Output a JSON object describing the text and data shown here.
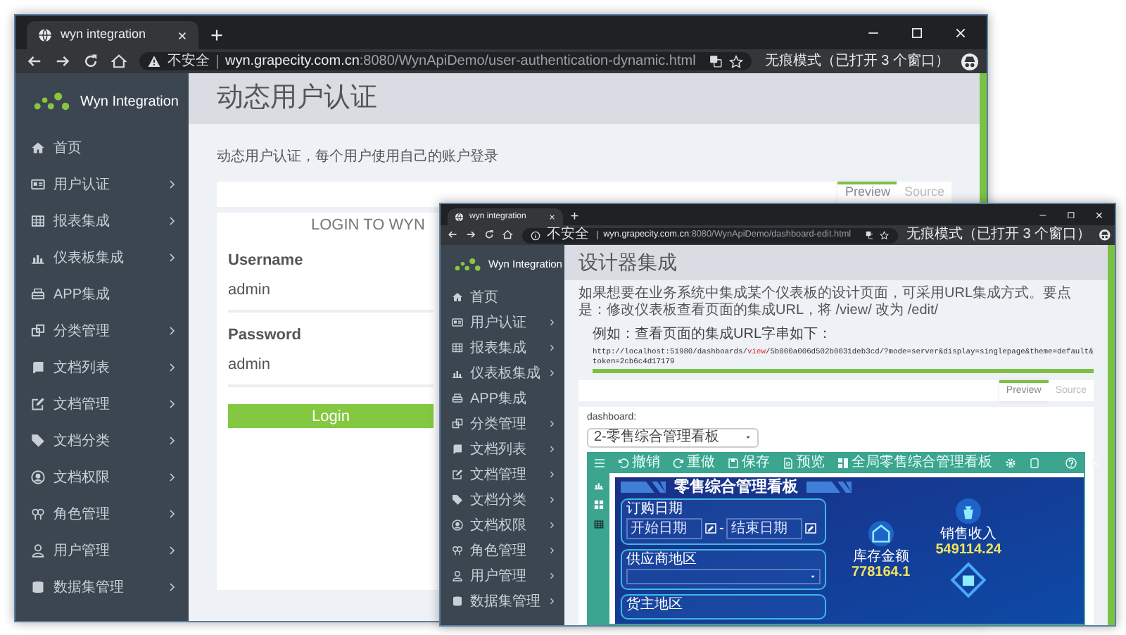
{
  "back_window": {
    "tab_title": "wyn integration",
    "security_label": "不安全",
    "url_host": "wyn.grapecity.com.cn",
    "url_path": ":8080/WynApiDemo/user-authentication-dynamic.html",
    "incognito_label": "无痕模式（已打开 3 个窗口）",
    "brand": "Wyn Integration",
    "sidebar": [
      {
        "label": "首页",
        "expandable": false
      },
      {
        "label": "用户认证",
        "expandable": true
      },
      {
        "label": "报表集成",
        "expandable": true
      },
      {
        "label": "仪表板集成",
        "expandable": true
      },
      {
        "label": "APP集成",
        "expandable": false
      },
      {
        "label": "分类管理",
        "expandable": true
      },
      {
        "label": "文档列表",
        "expandable": true
      },
      {
        "label": "文档管理",
        "expandable": true
      },
      {
        "label": "文档分类",
        "expandable": true
      },
      {
        "label": "文档权限",
        "expandable": true
      },
      {
        "label": "角色管理",
        "expandable": true
      },
      {
        "label": "用户管理",
        "expandable": true
      },
      {
        "label": "数据集管理",
        "expandable": true
      }
    ],
    "page_title": "动态用户认证",
    "description": "动态用户认证，每个用户使用自己的账户登录",
    "tabs": [
      {
        "label": "Preview",
        "selected": true
      },
      {
        "label": "Source",
        "selected": false
      }
    ],
    "login": {
      "heading": "LOGIN TO WYN",
      "fields": [
        {
          "label": "Username",
          "value": "admin"
        },
        {
          "label": "Password",
          "value": "admin"
        }
      ],
      "button": "Login"
    }
  },
  "front_window": {
    "tab_title": "wyn integration",
    "security_label": "不安全",
    "url_host": "wyn.grapecity.com.cn",
    "url_path": ":8080/WynApiDemo/dashboard-edit.html",
    "incognito_label": "无痕模式（已打开 3 个窗口）",
    "brand": "Wyn Integration",
    "sidebar": [
      {
        "label": "首页",
        "expandable": false
      },
      {
        "label": "用户认证",
        "expandable": true
      },
      {
        "label": "报表集成",
        "expandable": true
      },
      {
        "label": "仪表板集成",
        "expandable": true
      },
      {
        "label": "APP集成",
        "expandable": false
      },
      {
        "label": "分类管理",
        "expandable": true
      },
      {
        "label": "文档列表",
        "expandable": true
      },
      {
        "label": "文档管理",
        "expandable": true
      },
      {
        "label": "文档分类",
        "expandable": true
      },
      {
        "label": "文档权限",
        "expandable": true
      },
      {
        "label": "角色管理",
        "expandable": true
      },
      {
        "label": "用户管理",
        "expandable": true
      },
      {
        "label": "数据集管理",
        "expandable": true
      }
    ],
    "page_title": "设计器集成",
    "description": "如果想要在业务系统中集成某个仪表板的设计页面，可采用URL集成方式。要点是：修改仪表板查看页面的集成URL，将 /view/ 改为 /edit/",
    "example_label": "例如：查看页面的集成URL字串如下：",
    "example_url": [
      {
        "text": "http://localhost:51980/dashboards/",
        "kind": "plain"
      },
      {
        "text": "view",
        "kind": "highlight"
      },
      {
        "text": "/5b000a006d502b0031deb3cd/?mode=server&display=singlepage&theme=default&token=2cb6c4d17179",
        "kind": "plain"
      }
    ],
    "tabs": [
      {
        "label": "Preview",
        "selected": true
      },
      {
        "label": "Source",
        "selected": false
      }
    ],
    "dashboard_label": "dashboard:",
    "dashboard_select": "2-零售综合管理看板",
    "designer": {
      "toolbar": [
        "撤销",
        "重做",
        "保存",
        "预览"
      ],
      "document_title": "全局零售综合管理看板",
      "canvas": {
        "title": "零售综合管理看板",
        "filters": [
          {
            "label": "订购日期",
            "kind": "date_range",
            "start_placeholder": "开始日期",
            "separator": "-",
            "end_placeholder": "结束日期"
          },
          {
            "label": "供应商地区",
            "kind": "select"
          },
          {
            "label": "货主地区",
            "kind": "label_only"
          }
        ],
        "kpis": [
          {
            "label": "库存金额",
            "value": "778164.1"
          },
          {
            "label": "销售收入",
            "value": "549114.24"
          }
        ]
      }
    }
  }
}
